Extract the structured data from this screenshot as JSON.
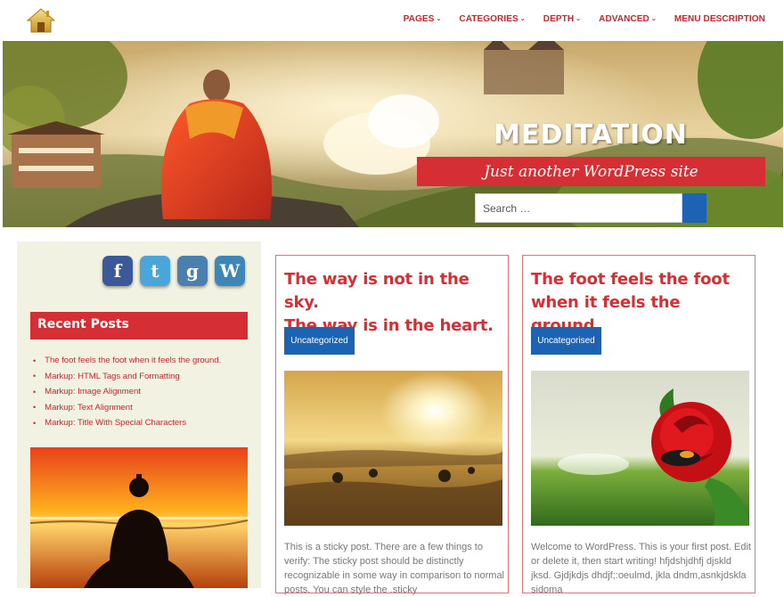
{
  "nav": {
    "items": [
      {
        "label": "PAGES",
        "chevron": true
      },
      {
        "label": "CATEGORIES",
        "chevron": true
      },
      {
        "label": "DEPTH",
        "chevron": true
      },
      {
        "label": "ADVANCED",
        "chevron": true
      },
      {
        "label": "MENU DESCRIPTION",
        "chevron": false
      }
    ]
  },
  "header": {
    "site_title": "MEDITATION",
    "tagline": "Just another WordPress site",
    "search_placeholder": "Search …"
  },
  "sidebar": {
    "social": [
      {
        "icon": "facebook-icon",
        "glyph": "f",
        "color": "#3b5998"
      },
      {
        "icon": "twitter-icon",
        "glyph": "t",
        "color": "#4aa5d8"
      },
      {
        "icon": "google-icon",
        "glyph": "g",
        "color": "#4a7fb0"
      },
      {
        "icon": "wordpress-icon",
        "glyph": "W",
        "color": "#3f86b8"
      }
    ],
    "recent_heading": "Recent Posts",
    "recent_posts": [
      "The foot feels the foot when it feels the ground.",
      "Markup: HTML Tags and Formatting",
      "Markup: Image Alignment",
      "Markup: Text Alignment",
      "Markup: Title With Special Characters"
    ]
  },
  "posts": [
    {
      "title_line1": "The way is not in the sky.",
      "title_line2": "The way is in the heart.",
      "category": "Uncategorized",
      "excerpt": "This is a sticky post. There are a few things to verify: The sticky post should be distinctly recognizable in some way in comparison to normal posts. You can style the .sticky"
    },
    {
      "title_line1": "The foot feels the foot",
      "title_line2": "when it feels the ground.",
      "category": "Uncategorised",
      "excerpt": "Welcome to WordPress. This is your first post. Edit or delete it, then start writing! hfjdshjdhfj djskld jksd. Gjdjkdjs dhdjf;:oeulmd, jkla dndm,asnkjdskla sidoma"
    }
  ],
  "colors": {
    "accent_red": "#d52f35",
    "accent_blue": "#1c64b3",
    "sidebar_bg": "#f1f2e1"
  }
}
